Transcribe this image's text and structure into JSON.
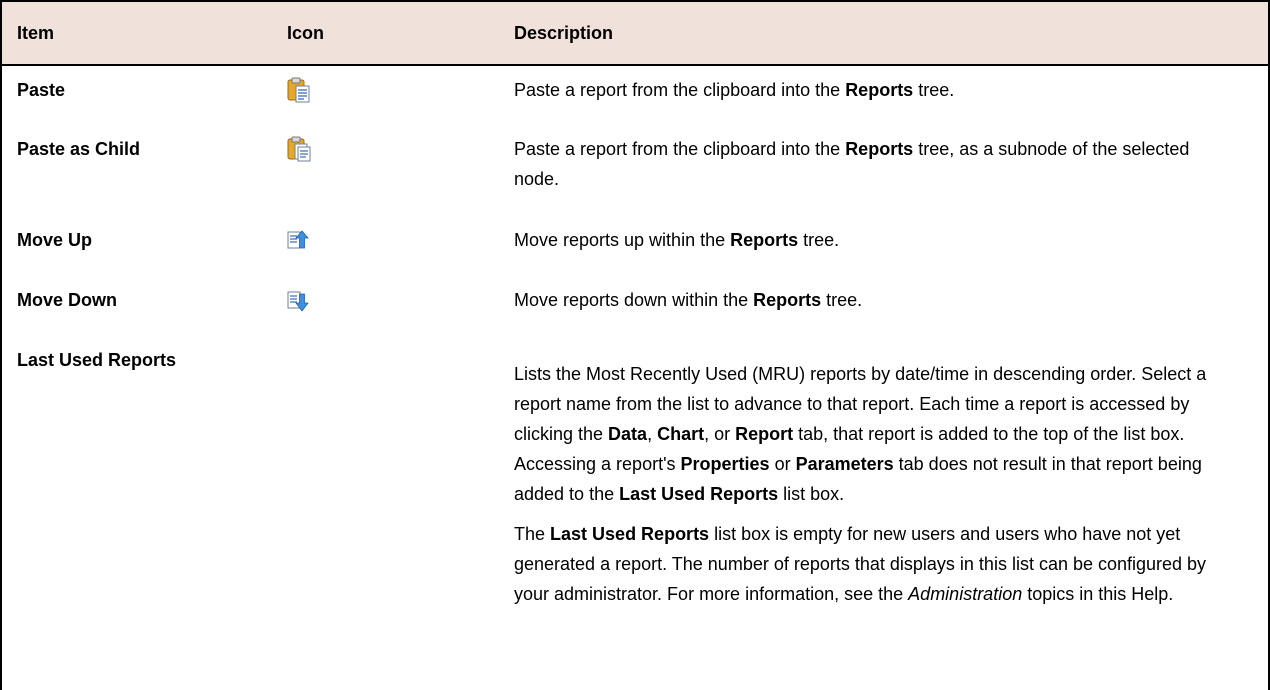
{
  "header": {
    "item": "Item",
    "icon": "Icon",
    "description": "Description"
  },
  "rows": [
    {
      "item": "Paste",
      "icon": "paste-icon"
    },
    {
      "item": "Paste as Child",
      "icon": "paste-as-child-icon"
    },
    {
      "item": "Move Up",
      "icon": "move-up-icon"
    },
    {
      "item": "Move Down",
      "icon": "move-down-icon"
    },
    {
      "item": "Last Used Reports",
      "icon": ""
    }
  ],
  "desc": {
    "paste": [
      "Paste a report from the clipboard into the ",
      "Reports",
      " tree."
    ],
    "paste_child": [
      "Paste a report from the clipboard into the ",
      "Reports",
      " tree, as a subnode of the selected node."
    ],
    "move_up": [
      "Move reports up within the ",
      "Reports",
      " tree."
    ],
    "move_down": [
      "Move reports down within the ",
      "Reports",
      " tree."
    ],
    "mru_p1": [
      "Lists the Most Recently Used (MRU) reports by date/time in descending order. Select a report name from the list to advance to that report. Each time a report is accessed by clicking the ",
      "Data",
      ", ",
      "Chart",
      ", or ",
      "Report",
      " tab, that report is added to the top of the list box. Accessing a report's ",
      "Properties",
      " or ",
      "Parameters",
      " tab does not result in that report being added to the ",
      "Last Used Reports",
      " list box."
    ],
    "mru_p2": [
      "The ",
      "Last Used Reports",
      " list box is empty for new users and users who have not yet generated a report. The number of reports that displays in this list can be configured by your administrator. For more information, see the ",
      "Administration",
      " topics in this Help."
    ]
  }
}
